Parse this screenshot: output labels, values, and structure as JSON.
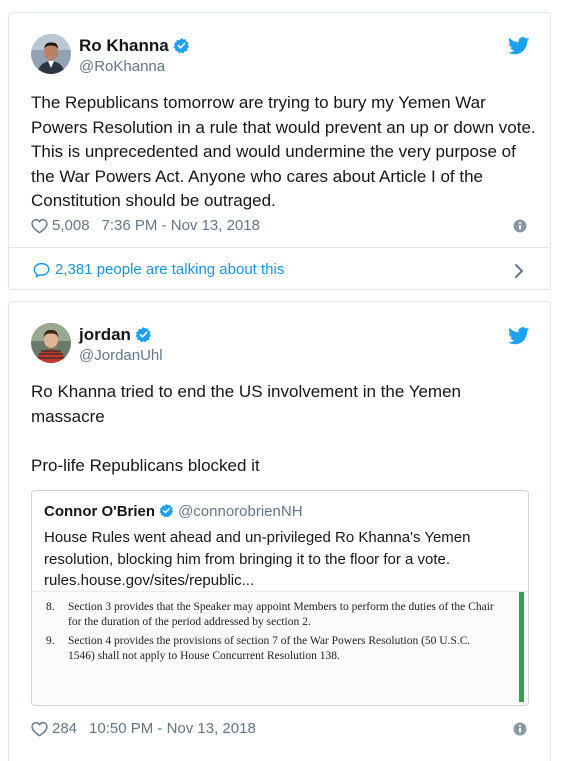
{
  "tweet1": {
    "name": "Ro Khanna",
    "handle": "@RoKhanna",
    "text": "The Republicans tomorrow are trying to bury my Yemen War Powers Resolution in a rule that would prevent an up or down vote. This is unprecedented and would undermine the very purpose of the War Powers Act. Anyone who cares about Article I of the Constitution should be outraged.",
    "likes": "5,008",
    "timestamp": "7:36 PM - Nov 13, 2018",
    "talking": "2,381 people are talking about this"
  },
  "tweet2": {
    "name": "jordan",
    "handle": "@JordanUhl",
    "text_line1": "Ro Khanna tried to end the US involvement in the Yemen massacre",
    "text_line2": "Pro-life Republicans blocked it",
    "likes": "284",
    "timestamp": "10:50 PM - Nov 13, 2018",
    "quote": {
      "name": "Connor O'Brien",
      "handle": "@connorobrienNH",
      "text": "House Rules went ahead and un-privileged Ro Khanna's Yemen resolution, blocking him from bringing it to the floor for a vote.",
      "link": "rules.house.gov/sites/republic...",
      "doc_items": [
        {
          "num": "8.",
          "text": "Section 3 provides that the Speaker may appoint Members to perform the duties of the Chair for the duration of the period addressed by section 2."
        },
        {
          "num": "9.",
          "text": "Section 4 provides the provisions of section 7 of the War Powers Resolution (50 U.S.C. 1546) shall not apply to House Concurrent Resolution 138."
        }
      ]
    }
  },
  "colors": {
    "twitter_blue": "#1da1f2",
    "link_blue": "#1b95e0",
    "muted": "#657786",
    "doc_bar_green": "#2aa74a"
  },
  "icons": [
    "verified-badge-icon",
    "twitter-bird-icon",
    "heart-icon",
    "info-icon",
    "speech-bubble-icon",
    "chevron-right-icon"
  ]
}
